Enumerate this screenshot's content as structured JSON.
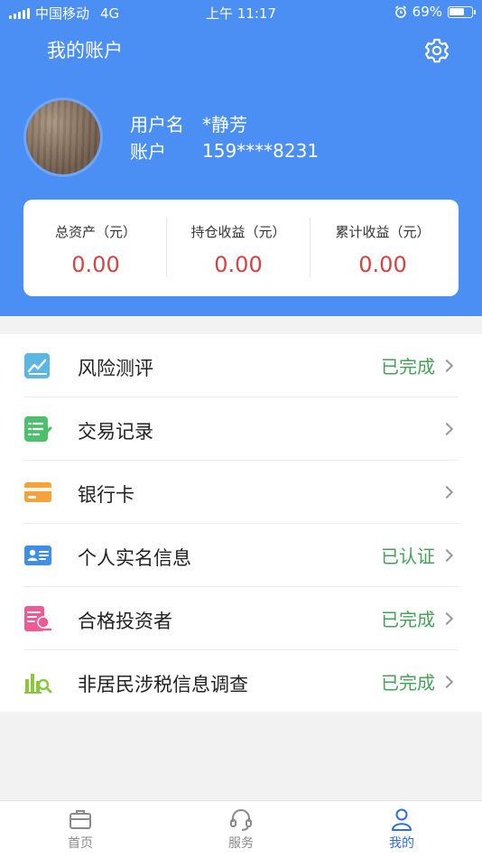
{
  "status_bar": {
    "carrier": "中国移动",
    "network": "4G",
    "time": "上午 11:17",
    "battery": "69%",
    "battery_level": 0.69
  },
  "header": {
    "title": "我的账户",
    "settings_icon": "gear-icon"
  },
  "profile": {
    "username_label": "用户名",
    "username": "*静芳",
    "account_label": "账户",
    "account": "159****8231"
  },
  "summary": [
    {
      "label": "总资产（元）",
      "value": "0.00"
    },
    {
      "label": "持仓收益（元）",
      "value": "0.00"
    },
    {
      "label": "累计收益（元）",
      "value": "0.00"
    }
  ],
  "menu": [
    {
      "label": "风险测评",
      "status": "已完成",
      "icon": "risk-assessment-icon",
      "color": "#5bb6e3"
    },
    {
      "label": "交易记录",
      "status": "",
      "icon": "transaction-record-icon",
      "color": "#4cbf6a"
    },
    {
      "label": "银行卡",
      "status": "",
      "icon": "bank-card-icon",
      "color": "#f5a23a"
    },
    {
      "label": "个人实名信息",
      "status": "已认证",
      "icon": "id-card-icon",
      "color": "#3f8fe8"
    },
    {
      "label": "合格投资者",
      "status": "已完成",
      "icon": "qualified-investor-icon",
      "color": "#ef5a95"
    },
    {
      "label": "非居民涉税信息调查",
      "status": "已完成",
      "icon": "tax-survey-icon",
      "color": "#8cc63f"
    }
  ],
  "tabs": [
    {
      "label": "首页",
      "icon": "briefcase-icon",
      "active": false
    },
    {
      "label": "服务",
      "icon": "headset-icon",
      "active": false
    },
    {
      "label": "我的",
      "icon": "person-icon",
      "active": true
    }
  ],
  "colors": {
    "header_bg": "#4b8ff4",
    "value_red": "#d64343",
    "status_green": "#46a05a",
    "tab_active": "#2f6fdc"
  }
}
